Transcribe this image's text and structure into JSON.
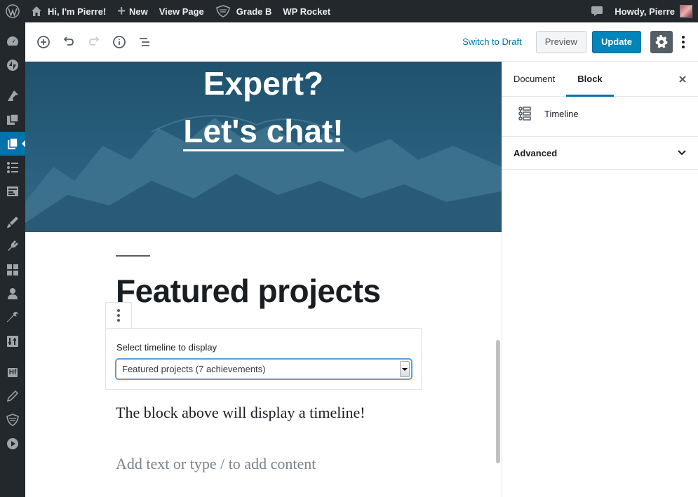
{
  "admin_bar": {
    "site_name": "Hi, I'm Pierre!",
    "new_label": "New",
    "view_page_label": "View Page",
    "grade_label": "Grade B",
    "wp_rocket_label": "WP Rocket",
    "howdy_label": "Howdy, Pierre"
  },
  "admin_menu": {
    "icons": [
      "dashboard-icon",
      "jetpack-icon",
      "posts-icon",
      "media-icon",
      "pages-icon",
      "timeline-icon",
      "forms-icon",
      "appearance-icon",
      "plugins-icon",
      "blocks-icon",
      "users-icon",
      "tools-icon",
      "settings-icon",
      "hf-icon",
      "editor-icon",
      "security-icon",
      "play-icon"
    ],
    "hf_text": "Hf",
    "active": "pages-icon"
  },
  "toolbar": {
    "switch_to_draft": "Switch to Draft",
    "preview": "Preview",
    "update": "Update"
  },
  "content": {
    "cover_line1": "Expert?",
    "cover_line2": "Let's chat!",
    "heading": "Featured projects",
    "timeline_block": {
      "label": "Select timeline to display",
      "selected": "Featured projects (7 achievements)"
    },
    "paragraph": "The block above will display a timeline!",
    "placeholder": "Add text or type / to add content"
  },
  "sidebar": {
    "tabs": [
      "Document",
      "Block"
    ],
    "active_tab": "Block",
    "block_name": "Timeline",
    "panel_advanced": "Advanced"
  },
  "colors": {
    "admin_bar": "#23282d",
    "accent": "#0073aa",
    "update_button": "#0085ba",
    "cover_overlay": "#2a5f7c"
  }
}
